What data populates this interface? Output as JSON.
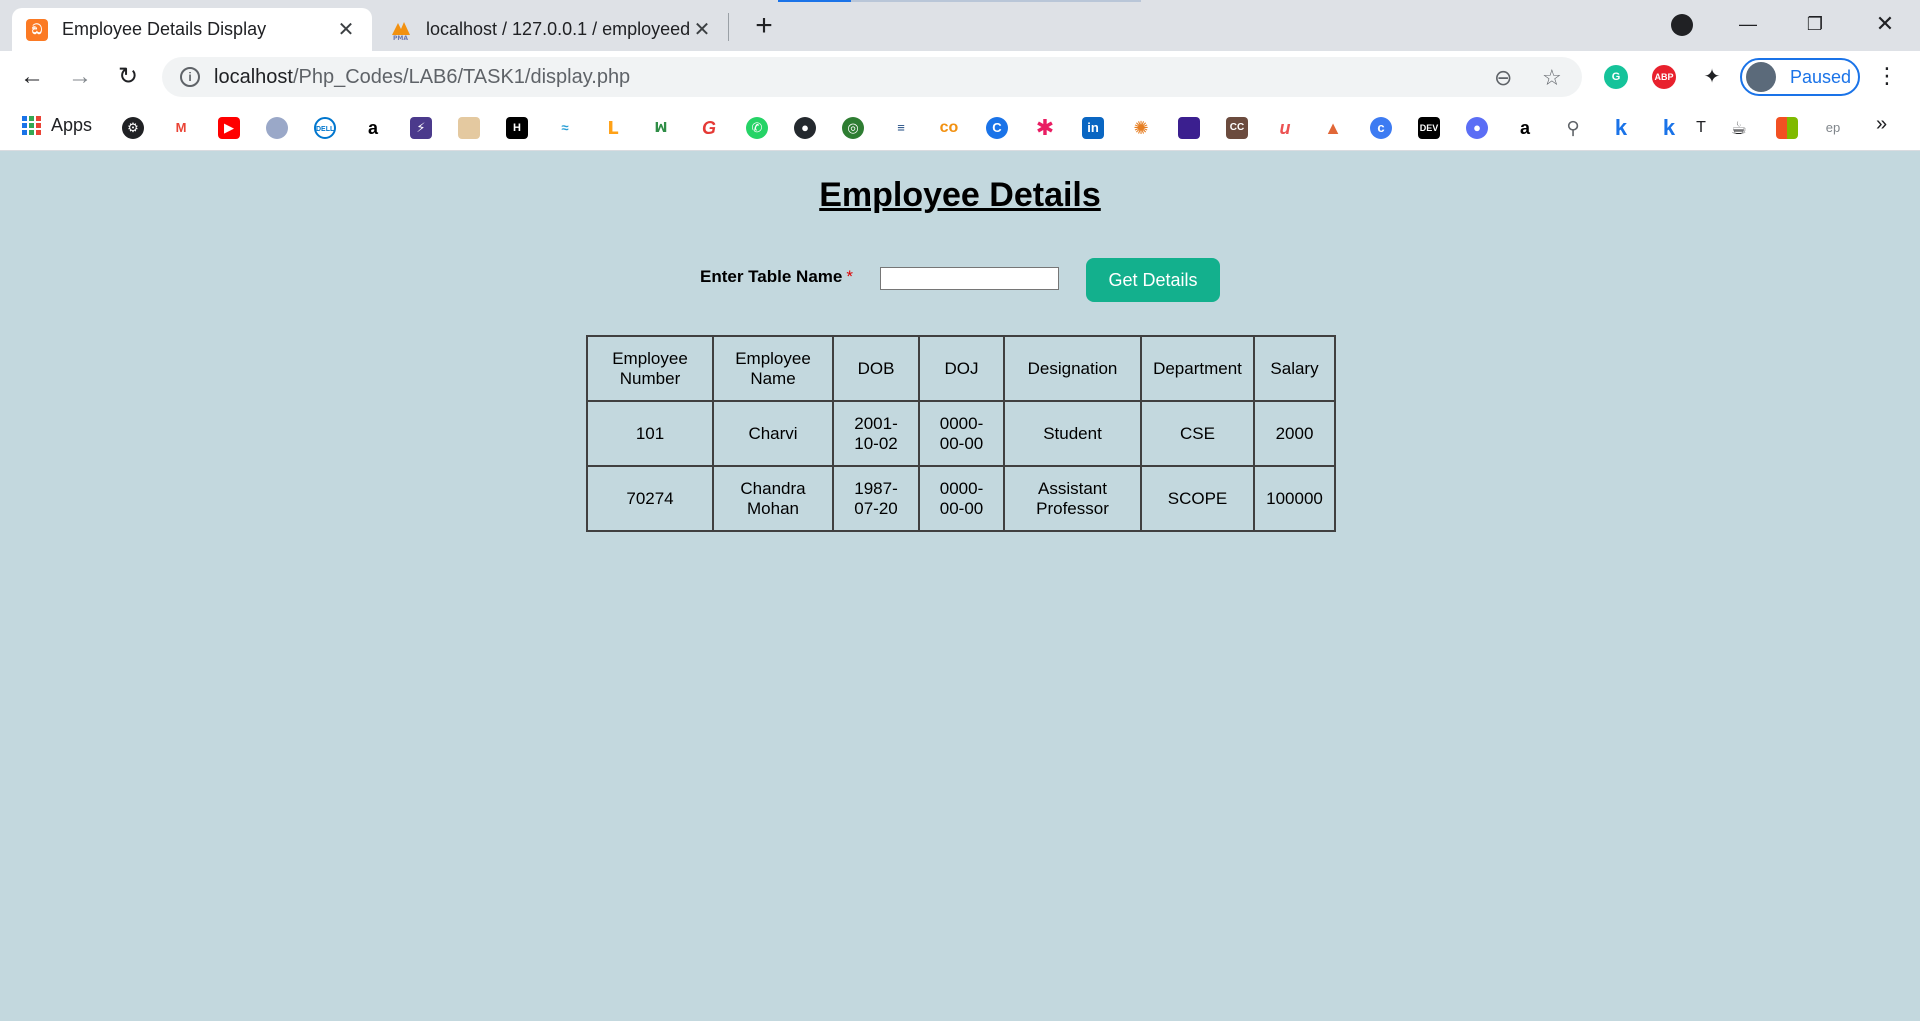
{
  "browser": {
    "tabs": [
      {
        "title": "Employee Details Display",
        "active": true
      },
      {
        "title": "localhost / 127.0.0.1 / employeed",
        "active": false
      }
    ],
    "address": {
      "host": "localhost",
      "path": "/Php_Codes/LAB6/TASK1/display.php"
    },
    "profile_label": "Paused",
    "bookmarks": {
      "apps_label": "Apps"
    }
  },
  "page": {
    "heading": "Employee Details",
    "form": {
      "label": "Enter Table Name",
      "required_mark": "*",
      "input_value": "",
      "button_label": "Get Details"
    },
    "table": {
      "headers": [
        [
          "Employee",
          "Number"
        ],
        [
          "Employee",
          "Name"
        ],
        [
          "DOB"
        ],
        [
          "DOJ"
        ],
        [
          "Designation"
        ],
        [
          "Department"
        ],
        [
          "Salary"
        ]
      ],
      "rows": [
        {
          "number": "101",
          "name": [
            "Charvi"
          ],
          "dob": [
            "2001-",
            "10-02"
          ],
          "doj": [
            "0000-",
            "00-00"
          ],
          "designation": [
            "Student"
          ],
          "department": "CSE",
          "salary": "2000"
        },
        {
          "number": "70274",
          "name": [
            "Chandra",
            "Mohan"
          ],
          "dob": [
            "1987-",
            "07-20"
          ],
          "doj": [
            "0000-",
            "00-00"
          ],
          "designation": [
            "Assistant",
            "Professor"
          ],
          "department": "SCOPE",
          "salary": "100000"
        }
      ]
    }
  },
  "colors": {
    "page_bg": "#c3d8de",
    "button_bg": "#13b08d",
    "tab_strip": "#dee1e6"
  }
}
